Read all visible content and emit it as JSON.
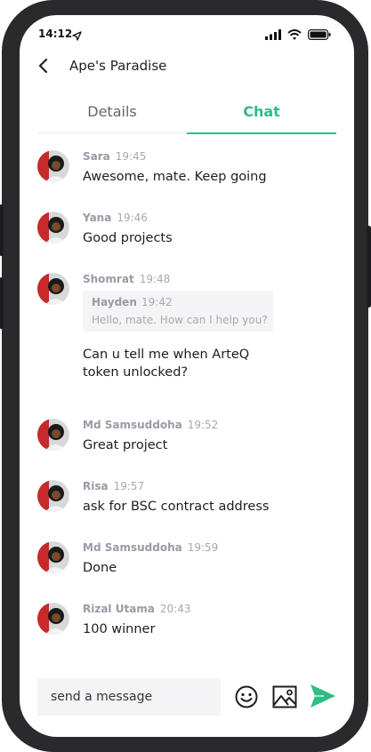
{
  "status": {
    "time": "14:12"
  },
  "header": {
    "title": "Ape's Paradise"
  },
  "tabs": [
    {
      "label": "Details"
    },
    {
      "label": "Chat"
    }
  ],
  "messages": [
    {
      "sender": "Sara",
      "time": "19:45",
      "text": "Awesome, mate. Keep going"
    },
    {
      "sender": "Yana",
      "time": "19:46",
      "text": "Good projects"
    },
    {
      "sender": "Shomrat",
      "time": "19:48",
      "text": "Can u tell me when ArteQ token unlocked?",
      "reply_to": {
        "sender": "Hayden",
        "time": "19:42",
        "text": "Hello, mate. How can I help you?"
      }
    },
    {
      "sender": "Md Samsuddoha",
      "time": "19:52",
      "text": "Great project"
    },
    {
      "sender": "Risa",
      "time": "19:57",
      "text": "ask for BSC contract address"
    },
    {
      "sender": "Md Samsuddoha",
      "time": "19:59",
      "text": "Done"
    },
    {
      "sender": "Rizal Utama",
      "time": "20:43",
      "text": "100 winner"
    }
  ],
  "composer": {
    "placeholder": "send a message"
  },
  "colors": {
    "accent": "#2ebd85",
    "frame": "#2a2a2c"
  },
  "icons": [
    "location-arrow-icon",
    "signal-icon",
    "wifi-icon",
    "battery-icon",
    "back-arrow-icon",
    "emoji-icon",
    "image-icon",
    "send-icon"
  ]
}
